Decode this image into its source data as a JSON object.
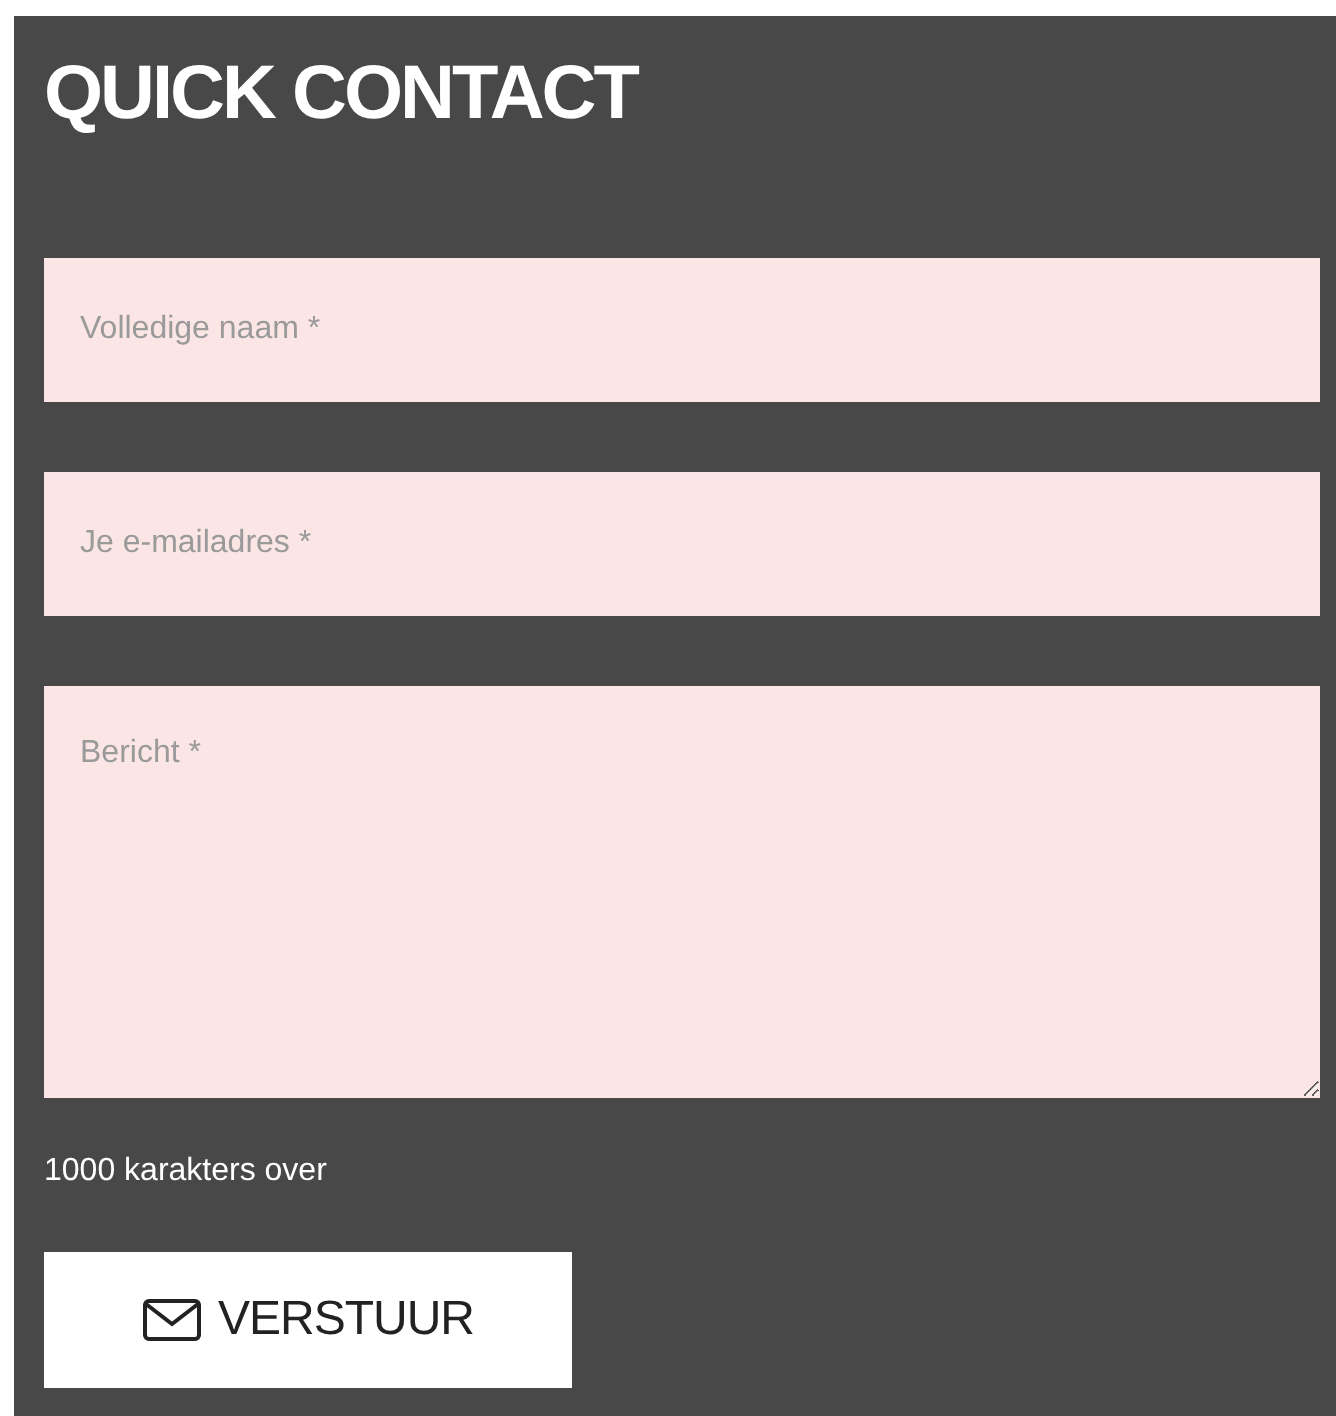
{
  "title": "QUICK CONTACT",
  "fields": [
    {
      "kind": "input",
      "placeholder": "Volledige naam *"
    },
    {
      "kind": "input",
      "placeholder": "Je e-mailadres *"
    },
    {
      "kind": "textarea",
      "placeholder": "Bericht *"
    }
  ],
  "counter": "1000 karakters over",
  "submit_button": {
    "label": "VERSTUUR"
  }
}
